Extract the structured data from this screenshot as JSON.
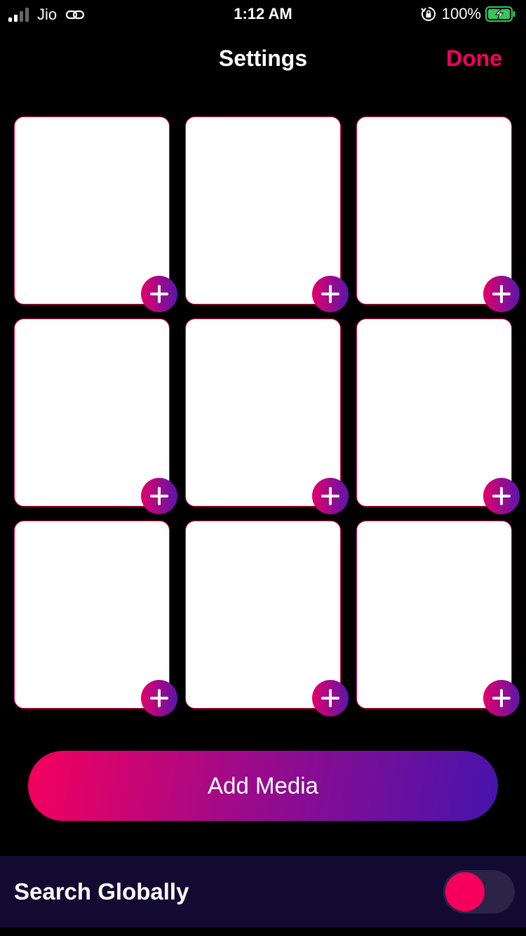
{
  "status_bar": {
    "carrier": "Jio",
    "time": "1:12 AM",
    "battery_percent": "100%",
    "icons": [
      "signal-icon",
      "link-icon",
      "orientation-lock-icon",
      "battery-charging-icon"
    ],
    "battery_fill_color": "#34c759"
  },
  "nav": {
    "title": "Settings",
    "done_label": "Done"
  },
  "media_grid": {
    "slot_count": 9,
    "slot_icon": "plus-icon"
  },
  "add_media": {
    "label": "Add Media"
  },
  "search_globally": {
    "label": "Search Globally",
    "toggle_on": false
  },
  "colors": {
    "accent": "#f5005d",
    "gradient_end": "#4614ad",
    "background": "#000000",
    "row_background": "#130a32"
  }
}
